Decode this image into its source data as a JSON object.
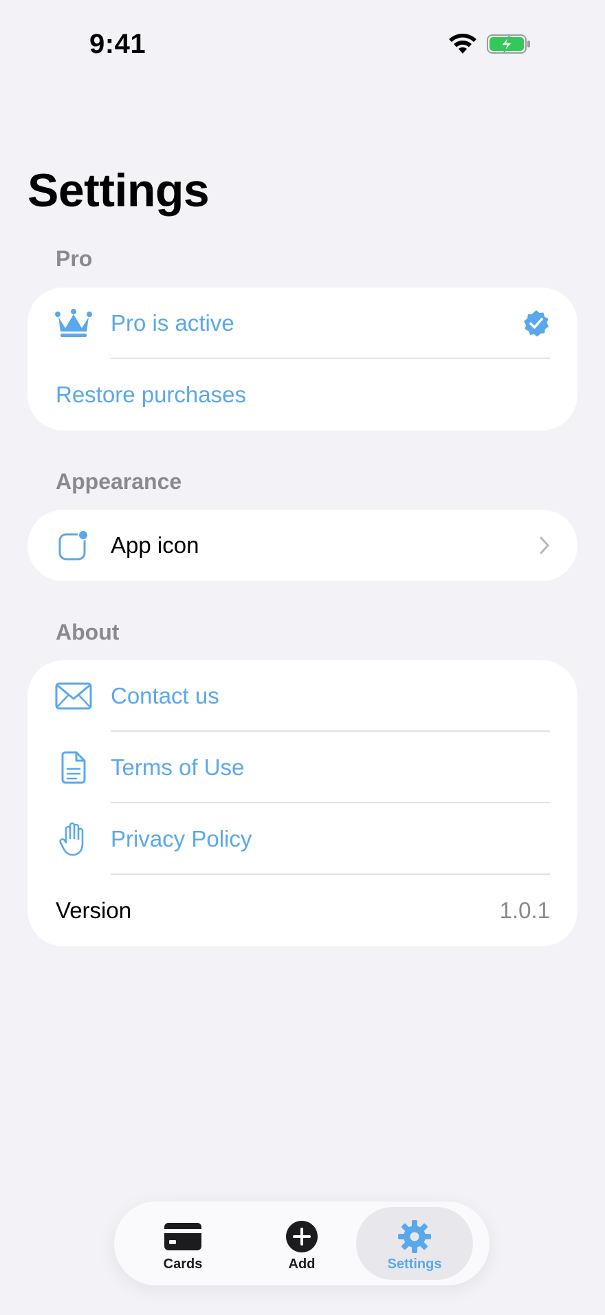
{
  "status_bar": {
    "time": "9:41",
    "wifi_icon": "wifi-icon",
    "battery_icon": "battery-charging-icon",
    "battery_color": "#34c759"
  },
  "page": {
    "title": "Settings"
  },
  "sections": {
    "pro": {
      "header": "Pro",
      "pro_status": {
        "label": "Pro is active",
        "icon": "crown-icon",
        "trailing_icon": "verified-badge-icon"
      },
      "restore": {
        "label": "Restore purchases"
      }
    },
    "appearance": {
      "header": "Appearance",
      "app_icon": {
        "label": "App icon",
        "icon": "app-icon-badge-icon",
        "trailing_icon": "chevron-right-icon"
      }
    },
    "about": {
      "header": "About",
      "contact": {
        "label": "Contact us",
        "icon": "envelope-icon"
      },
      "terms": {
        "label": "Terms of Use",
        "icon": "document-icon"
      },
      "privacy": {
        "label": "Privacy Policy",
        "icon": "hand-raised-icon"
      },
      "version": {
        "label": "Version",
        "value": "1.0.1"
      }
    }
  },
  "tab_bar": {
    "tabs": [
      {
        "label": "Cards",
        "icon": "credit-card-icon",
        "active": false
      },
      {
        "label": "Add",
        "icon": "plus-circle-icon",
        "active": false
      },
      {
        "label": "Settings",
        "icon": "gear-icon",
        "active": true
      }
    ]
  },
  "colors": {
    "accent": "#5aa8ec",
    "background": "#f2f2f7",
    "card": "#ffffff",
    "secondary_text": "#8a8a8e"
  }
}
